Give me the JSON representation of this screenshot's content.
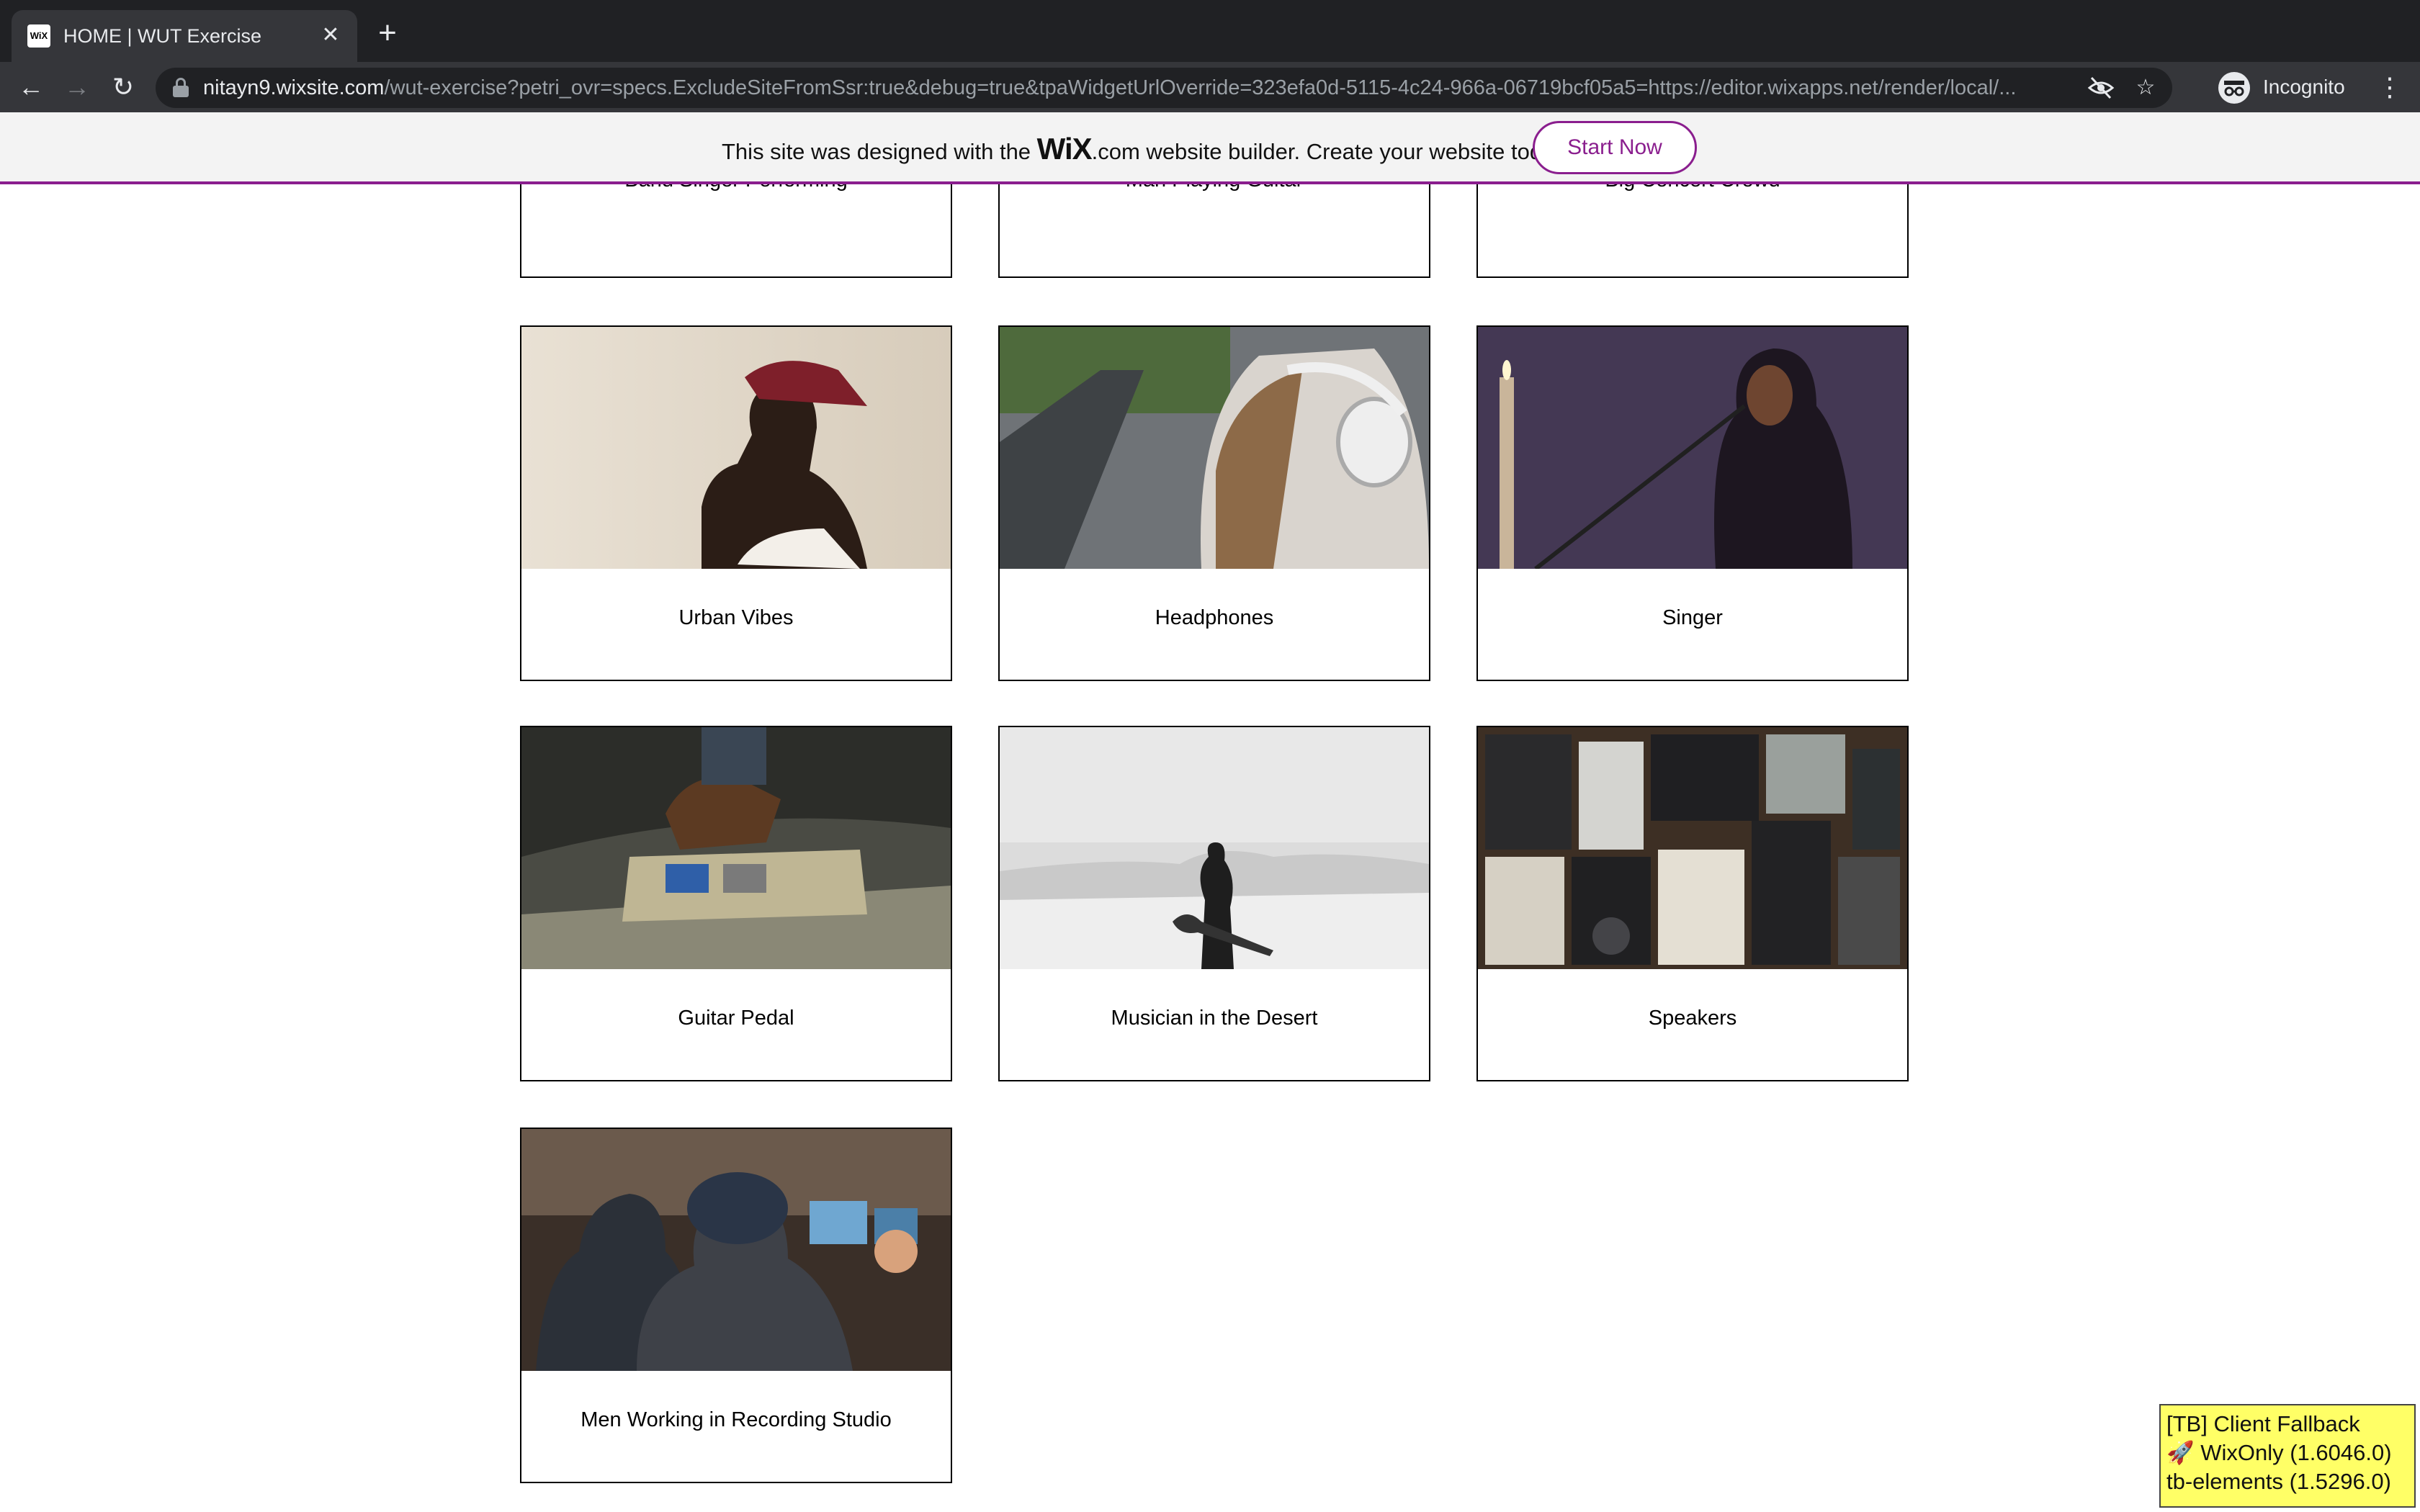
{
  "browser": {
    "tab": {
      "favicon": "WiX",
      "title": "HOME | WUT Exercise",
      "close_icon": "close-icon"
    },
    "new_tab_icon": "plus-icon",
    "nav": {
      "back_icon": "arrow-left-icon",
      "forward_icon": "arrow-right-icon",
      "reload_icon": "reload-icon"
    },
    "address": {
      "host": "nitayn9.wixsite.com",
      "path": "/wut-exercise?petri_ovr=specs.ExcludeSiteFromSsr:true&debug=true&tpaWidgetUrlOverride=323efa0d-5115-4c24-966a-06719bcf05a5=https://editor.wixapps.net/render/local/..."
    },
    "profile_label": "Incognito"
  },
  "wix_banner": {
    "text_before": "This site was designed with the ",
    "logo": "WiX",
    "text_after": ".com website builder. Create your website today.",
    "cta": "Start Now",
    "accent_color": "#8a1e8e"
  },
  "gallery": {
    "items": [
      {
        "title": "Band Singer Performing"
      },
      {
        "title": "Man Playing Guitar"
      },
      {
        "title": "Big Concert Crowd"
      },
      {
        "title": "Urban Vibes"
      },
      {
        "title": "Headphones"
      },
      {
        "title": "Singer"
      },
      {
        "title": "Guitar Pedal"
      },
      {
        "title": "Musician in the Desert"
      },
      {
        "title": "Speakers"
      },
      {
        "title": "Men Working in Recording Studio"
      }
    ]
  },
  "dev_overlay": {
    "line1": "[TB] Client Fallback",
    "line2": "🚀 WixOnly (1.6046.0)",
    "line3": "tb-elements (1.5296.0)"
  }
}
